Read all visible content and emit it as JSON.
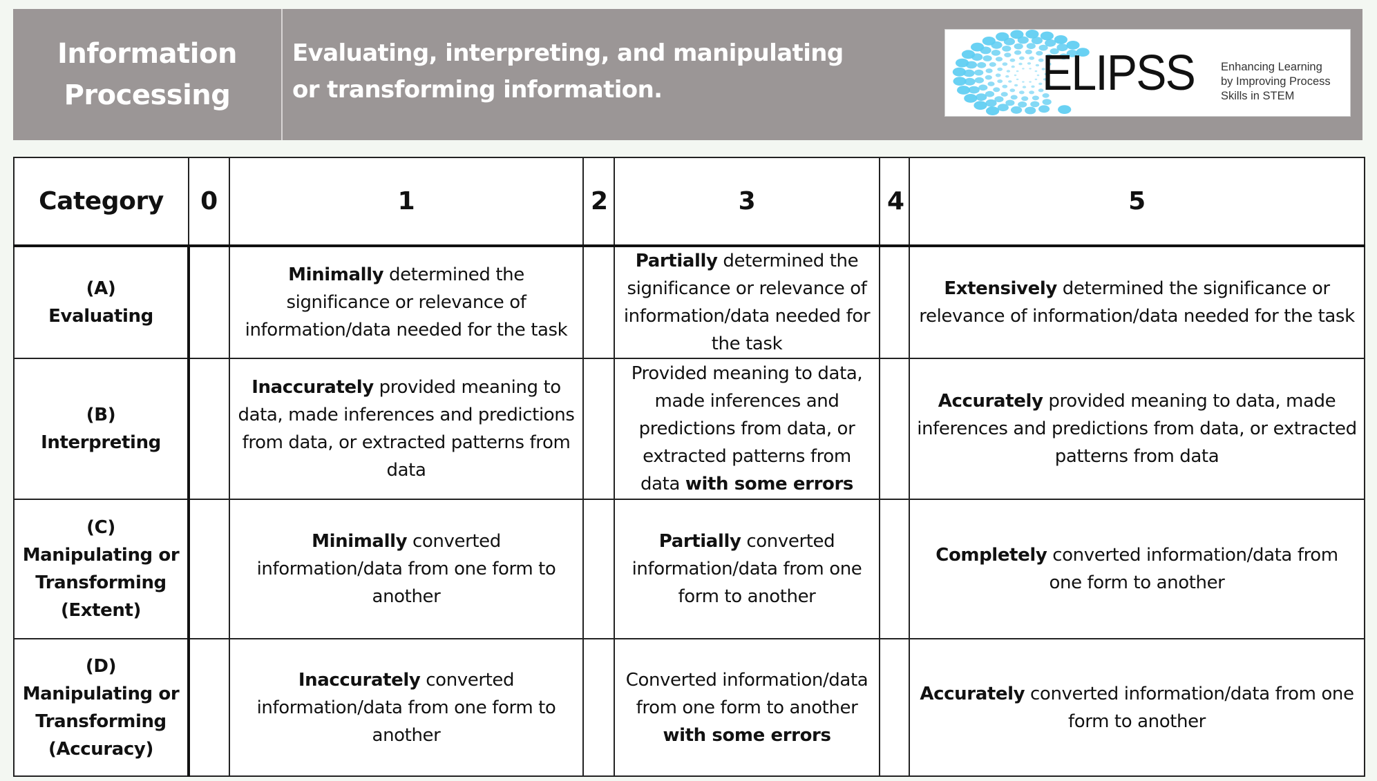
{
  "header": {
    "title_line1": "Information",
    "title_line2": "Processing",
    "subtitle_line1": "Evaluating, interpreting, and manipulating",
    "subtitle_line2": "or transforming information.",
    "logo": {
      "wordmark": "ELIPSS",
      "tagline_line1": "Enhancing Learning",
      "tagline_line2": "by Improving Process",
      "tagline_line3": "Skills in STEM",
      "dot_color": "#5ecdf2"
    }
  },
  "table": {
    "columns": [
      "Category",
      "0",
      "1",
      "2",
      "3",
      "4",
      "5"
    ],
    "rows": [
      {
        "letter": "(A)",
        "name_lines": [
          "Evaluating"
        ],
        "score1": {
          "bold": "Minimally",
          "rest": " determined the significance or relevance of information/data needed for the task"
        },
        "score3": {
          "bold": "Partially",
          "rest": " determined the significance or relevance of information/data needed for the task"
        },
        "score5": {
          "bold": "Extensively",
          "rest": " determined the significance or relevance of information/data needed for the task"
        }
      },
      {
        "letter": "(B)",
        "name_lines": [
          "Interpreting"
        ],
        "score1": {
          "bold": "Inaccurately",
          "rest": " provided meaning to data, made inferences and predictions from data, or extracted patterns from data"
        },
        "score3": {
          "pre": "Provided meaning to data, made inferences and predictions from data, or extracted patterns from data ",
          "bold": "with some errors"
        },
        "score5": {
          "bold": "Accurately",
          "rest": " provided meaning to data, made inferences and predictions from data, or extracted patterns from data"
        }
      },
      {
        "letter": "(C)",
        "name_lines": [
          "Manipulating or",
          "Transforming",
          "(Extent)"
        ],
        "score1": {
          "bold": "Minimally",
          "rest": " converted information/data from one form to another"
        },
        "score3": {
          "bold": "Partially",
          "rest": " converted information/data from one form to another"
        },
        "score5": {
          "bold": "Completely",
          "rest": " converted information/data from one form to another"
        }
      },
      {
        "letter": "(D)",
        "name_lines": [
          "Manipulating or",
          "Transforming",
          "(Accuracy)"
        ],
        "score1": {
          "bold": "Inaccurately",
          "rest": " converted information/data from one form to another"
        },
        "score3": {
          "pre": "Converted information/data from one form to another ",
          "bold": "with some errors"
        },
        "score5": {
          "bold": "Accurately",
          "rest": " converted information/data from one form to another"
        }
      }
    ]
  }
}
